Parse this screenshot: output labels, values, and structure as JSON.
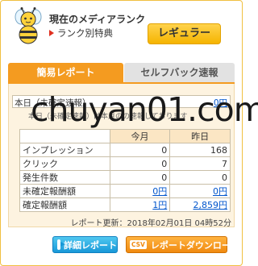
{
  "header": {
    "title": "現在のメディアランク",
    "rank_benefit_link": "ランク別特典",
    "rank_value": "レギュラー"
  },
  "tabs": [
    {
      "label": "簡易レポート",
      "active": true
    },
    {
      "label": "セルフバック速報",
      "active": false
    }
  ],
  "unconfirmed": {
    "label": "本日（未確定速報）",
    "value": "0円"
  },
  "note": "本日（未確定速報）は本月のの速報しております",
  "watermark": "chuyan01.com",
  "table": {
    "columns": [
      "",
      "今月",
      "昨日"
    ],
    "rows": [
      {
        "label": "インプレッション",
        "this_month": "0",
        "yesterday": "168",
        "link": false
      },
      {
        "label": "クリック",
        "this_month": "0",
        "yesterday": "7",
        "link": false
      },
      {
        "label": "発生件数",
        "this_month": "0",
        "yesterday": "0",
        "link": false
      },
      {
        "label": "未確定報酬額",
        "this_month": "0円",
        "yesterday": "0円",
        "link": true
      },
      {
        "label": "確定報酬額",
        "this_month": "1円",
        "yesterday": "2,859円",
        "link": true
      }
    ]
  },
  "update_text": "レポート更新：2018年02月01日 04時52分",
  "buttons": {
    "detail": "詳細レポート",
    "csv_tag": "CSV",
    "csv": "レポートダウンロード"
  },
  "colors": {
    "accent_orange": "#f49b20",
    "rank_yellow": "#f5b400",
    "link_blue": "#0055cc",
    "button_blue": "#1898d8"
  }
}
